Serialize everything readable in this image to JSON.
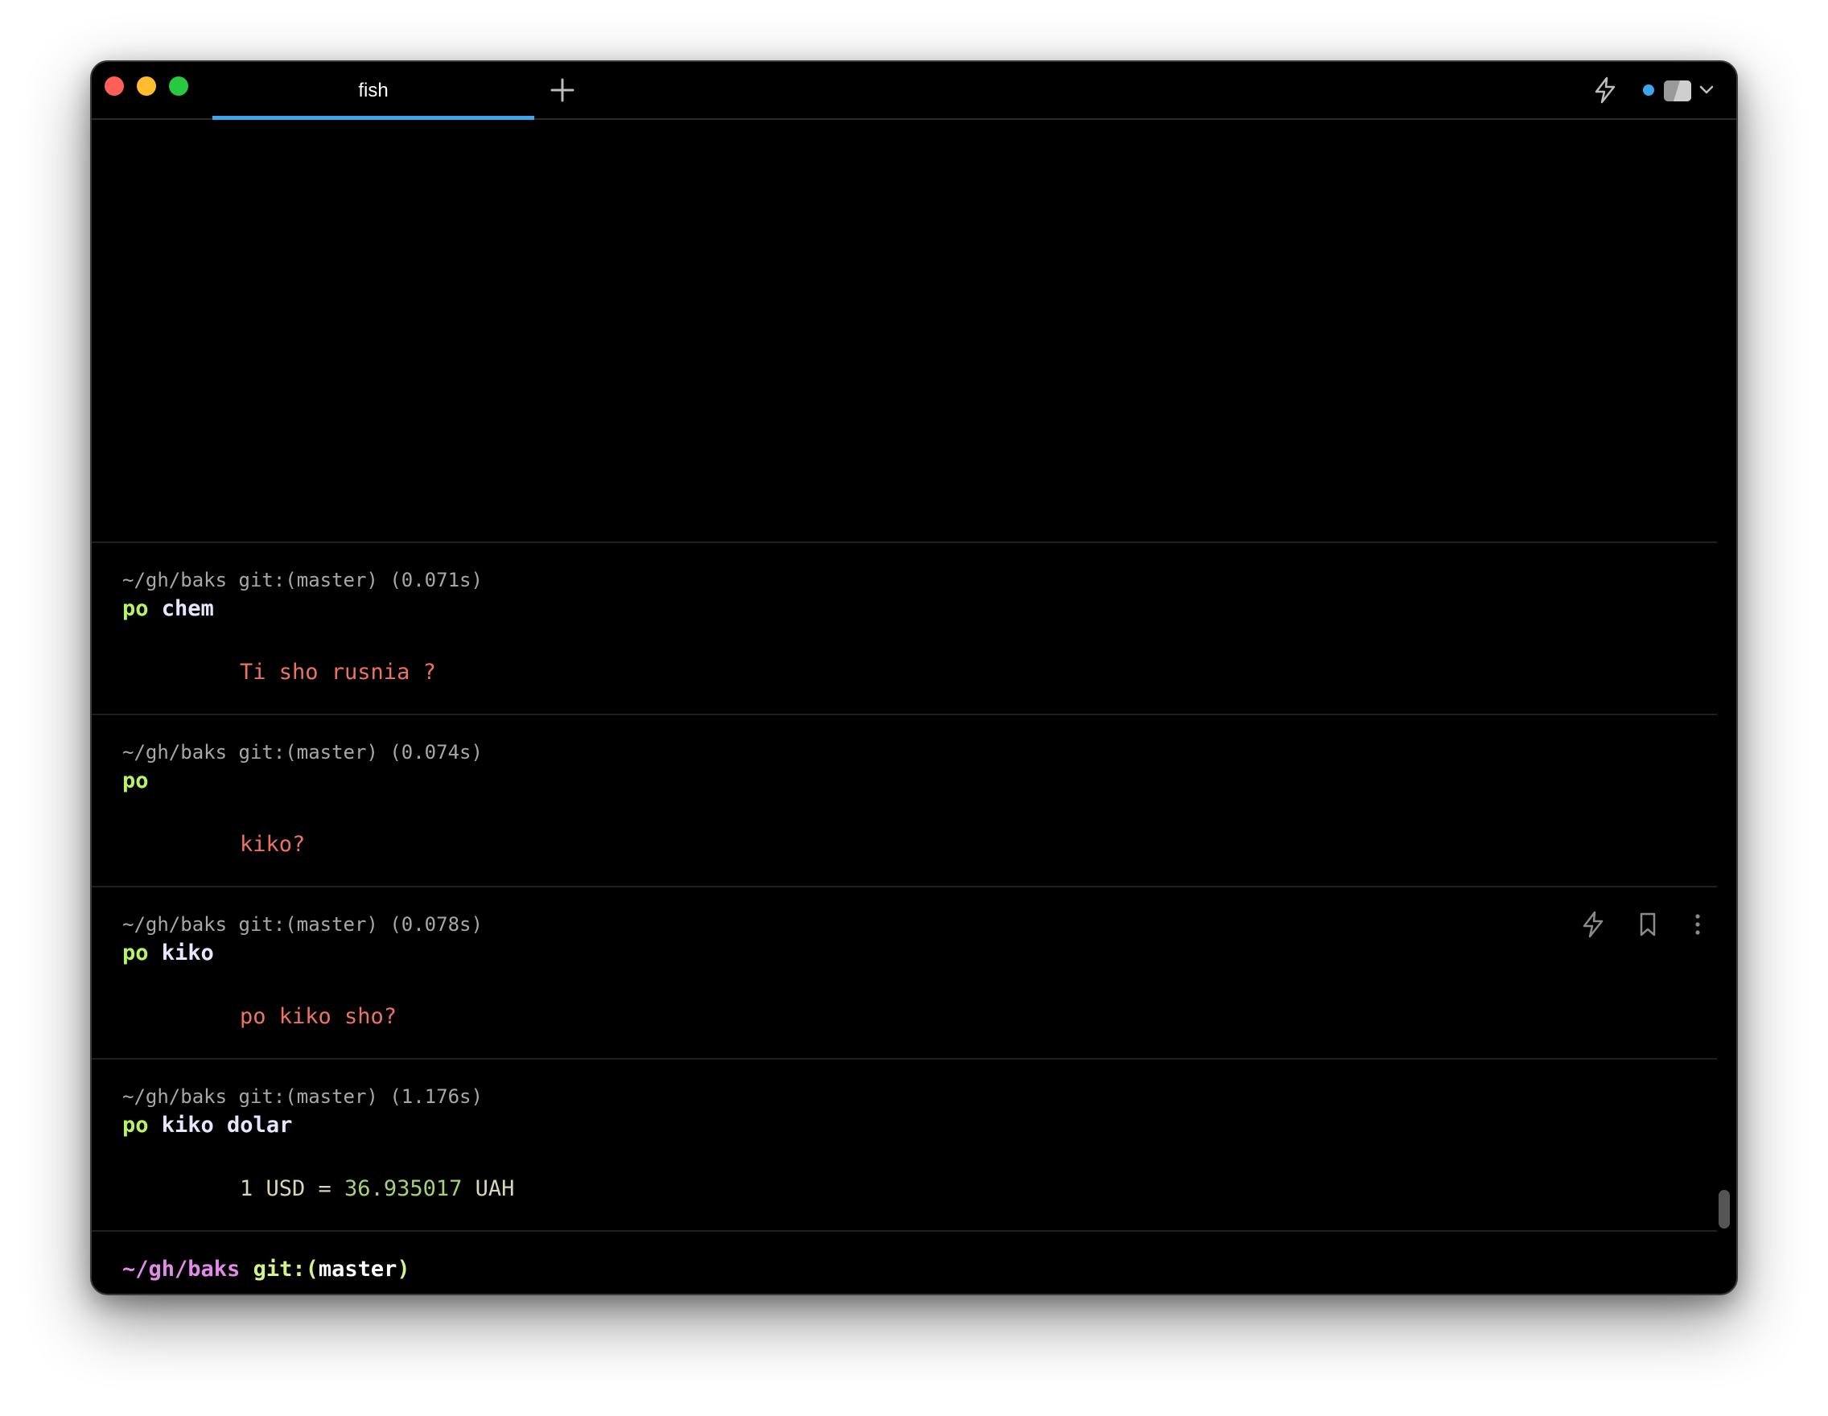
{
  "window": {
    "tab_title": "fish"
  },
  "icons": {
    "new_tab": "plus-icon",
    "workflow": "lightning-icon",
    "bookmark": "bookmark-icon",
    "more": "more-vertical-icon",
    "profile": "profile-icon",
    "dropdown": "chevron-down-icon"
  },
  "colors": {
    "accent": "#3ea6ea",
    "command": "#b7f364",
    "error_output": "#ec7362",
    "number_output": "#a6d174",
    "prompt_path": "#e38be8"
  },
  "blocks": [
    {
      "prompt": "~/gh/baks git:(master) (0.071s)",
      "command": "po",
      "args": " chem",
      "output": "Ti sho rusnia ?"
    },
    {
      "prompt": "~/gh/baks git:(master) (0.074s)",
      "command": "po",
      "args": "",
      "output": "kiko?"
    },
    {
      "prompt": "~/gh/baks git:(master) (0.078s)",
      "command": "po",
      "args": " kiko",
      "output": "po kiko sho?"
    },
    {
      "prompt": "~/gh/baks git:(master) (1.176s)",
      "command": "po",
      "args": " kiko dolar",
      "output_prefix": "1 USD = ",
      "output_value": "36.935017",
      "output_suffix": " UAH"
    }
  ],
  "current_prompt": {
    "path": "~/gh/baks",
    "git": " git:(",
    "branch": "master",
    "git_close": ")"
  }
}
